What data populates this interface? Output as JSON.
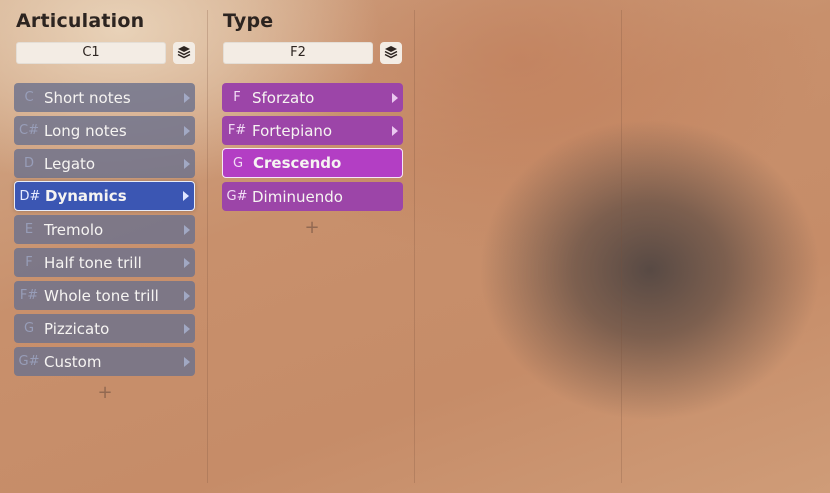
{
  "articulation": {
    "title": "Articulation",
    "key": "C1",
    "add_symbol": "+",
    "items": [
      {
        "note": "C",
        "label": "Short notes"
      },
      {
        "note": "C#",
        "label": "Long notes"
      },
      {
        "note": "D",
        "label": "Legato"
      },
      {
        "note": "D#",
        "label": "Dynamics"
      },
      {
        "note": "E",
        "label": "Tremolo"
      },
      {
        "note": "F",
        "label": "Half tone trill"
      },
      {
        "note": "F#",
        "label": "Whole tone trill"
      },
      {
        "note": "G",
        "label": "Pizzicato"
      },
      {
        "note": "G#",
        "label": "Custom"
      }
    ],
    "selected_index": 3
  },
  "type": {
    "title": "Type",
    "key": "F2",
    "add_symbol": "+",
    "items": [
      {
        "note": "F",
        "label": "Sforzato"
      },
      {
        "note": "F#",
        "label": "Fortepiano"
      },
      {
        "note": "G",
        "label": "Crescendo"
      },
      {
        "note": "G#",
        "label": "Diminuendo"
      }
    ],
    "selected_index": 2
  },
  "colors": {
    "articulation_item": "#6c728c",
    "articulation_selected": "#3b56b3",
    "type_item": "#9c45a8",
    "type_selected": "#b33ec4"
  }
}
